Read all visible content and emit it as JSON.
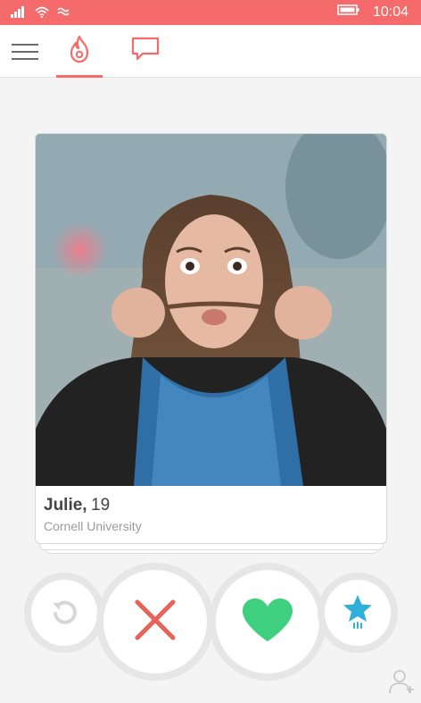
{
  "status_bar": {
    "time": "10:04",
    "icons": [
      "signal-icon",
      "wifi-icon",
      "data-sync-icon",
      "battery-icon"
    ]
  },
  "header": {
    "menu_icon": "hamburger-icon",
    "tabs": [
      {
        "name": "tab-flame",
        "icon": "flame-icon",
        "active": true
      },
      {
        "name": "tab-messages",
        "icon": "chat-bubble-icon",
        "active": false
      }
    ]
  },
  "card": {
    "name": "Julie,",
    "age": "19",
    "school": "Cornell University"
  },
  "actions": [
    {
      "name": "rewind-button",
      "icon": "rewind-icon"
    },
    {
      "name": "nope-button",
      "icon": "close-x-icon"
    },
    {
      "name": "like-button",
      "icon": "heart-icon"
    },
    {
      "name": "super-like-button",
      "icon": "star-icon"
    }
  ],
  "colors": {
    "accent": "#f56a6a",
    "like": "#3ecf7f",
    "nope": "#e8625a",
    "super_like": "#2fb0d8",
    "rewind": "#d6d6d6"
  }
}
